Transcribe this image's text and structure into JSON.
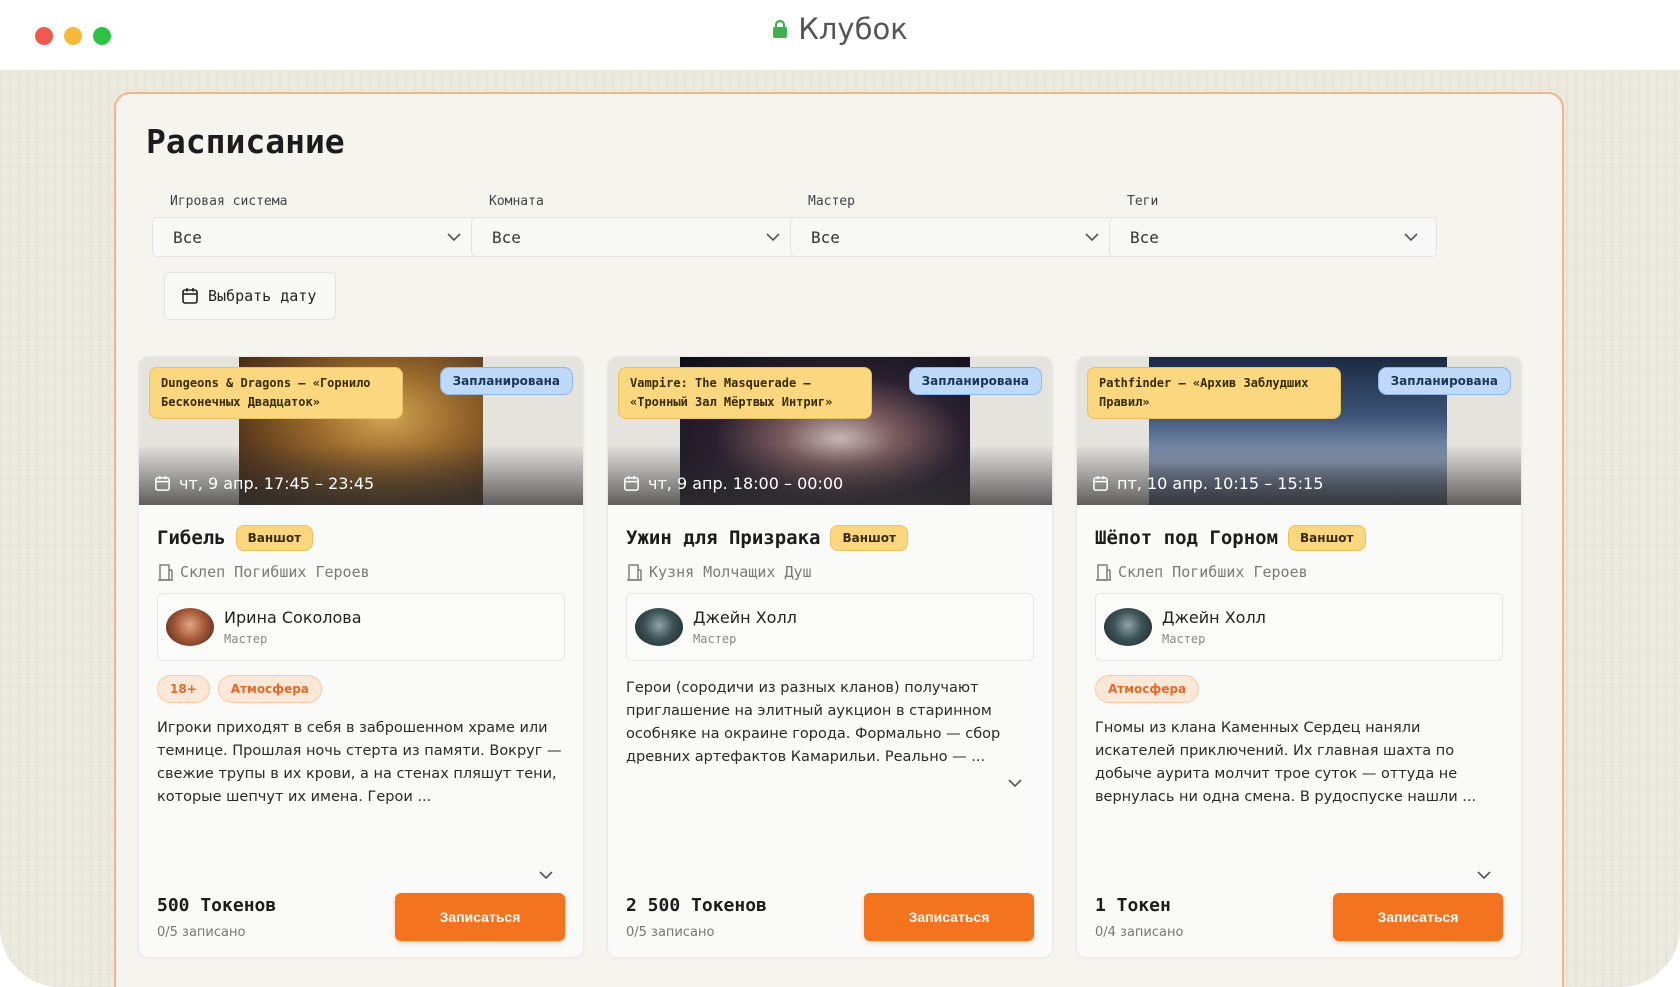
{
  "window": {
    "title": "Клубок"
  },
  "page": {
    "title": "Расписание"
  },
  "filters": [
    {
      "label": "Игровая система",
      "value": "Все"
    },
    {
      "label": "Комната",
      "value": "Все"
    },
    {
      "label": "Мастер",
      "value": "Все"
    },
    {
      "label": "Теги",
      "value": "Все"
    }
  ],
  "date_button": {
    "label": "Выбрать дату",
    "icon": "calendar-icon"
  },
  "colors": {
    "accent": "#f3731e",
    "system_badge": "#fbd87f",
    "status_badge": "#bfd9fb",
    "border": "#f2b48a"
  },
  "cards": [
    {
      "system": "Dungeons & Dragons — «Горнило Бесконечных Двадцаток»",
      "status": "Запланирована",
      "time": "чт, 9 апр. 17:45 – 23:45",
      "title": "Гибель",
      "format": "Ваншот",
      "room": "Склеп Погибших Героев",
      "master": {
        "name": "Ирина Соколова",
        "role": "Мастер"
      },
      "tags": [
        "18+",
        "Атмосфера"
      ],
      "description": "Игроки приходят в себя в заброшенном храме или темнице. Прошлая ночь стерта из памяти. Вокруг — свежие трупы в их крови, а на стенах пляшут тени, которые шепчут их имена. Герои ...",
      "price": "500 Токенов",
      "enrolled": "0/5 записано",
      "signup": "Записаться"
    },
    {
      "system": "Vampire: The Masquerade — «Тронный Зал Мёртвых Интриг»",
      "status": "Запланирована",
      "time": "чт, 9 апр. 18:00 – 00:00",
      "title": "Ужин для Призрака",
      "format": "Ваншот",
      "room": "Кузня Молчащих Душ",
      "master": {
        "name": "Джейн Холл",
        "role": "Мастер"
      },
      "tags": [],
      "description": "Герои (сородичи из разных кланов) получают приглашение на элитный аукцион в старинном особняке на окраине города. Формально — сбор древних артефактов Камарильи. Реально — ...",
      "price": "2 500 Токенов",
      "enrolled": "0/5 записано",
      "signup": "Записаться"
    },
    {
      "system": "Pathfinder — «Архив Заблудших Правил»",
      "status": "Запланирована",
      "time": "пт, 10 апр. 10:15 – 15:15",
      "title": "Шёпот под Горном",
      "format": "Ваншот",
      "room": "Склеп Погибших Героев",
      "master": {
        "name": "Джейн Холл",
        "role": "Мастер"
      },
      "tags": [
        "Атмосфера"
      ],
      "description": "Гномы из клана Каменных Сердец наняли искателей приключений. Их главная шахта по добыче аурита молчит трое суток — оттуда не вернулась ни одна смена. В рудоспуске нашли ...",
      "price": "1 Токен",
      "enrolled": "0/4 записано",
      "signup": "Записаться"
    }
  ]
}
